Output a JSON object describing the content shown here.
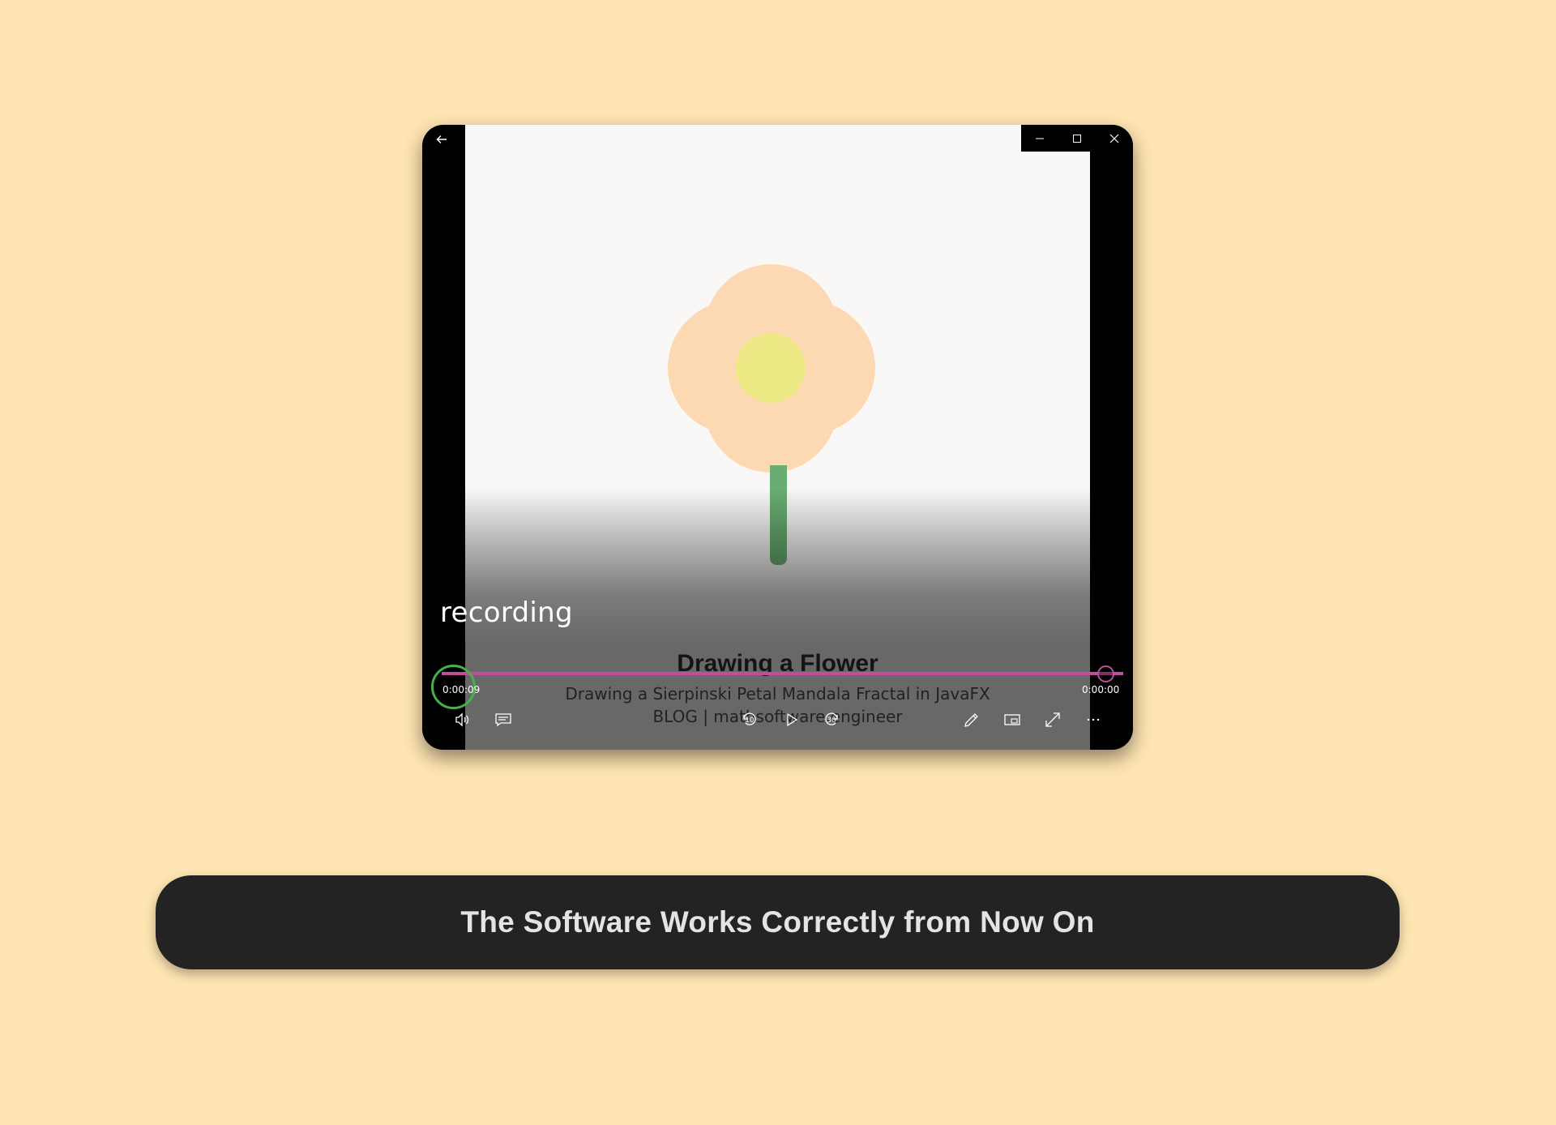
{
  "player": {
    "video_title": "Drawing a Flower",
    "video_subtitle_line1": "Drawing a Sierpinski Petal Mandala Fractal in JavaFX",
    "video_subtitle_line2": "BLOG | mathsoftware.engineer",
    "caption": "recording",
    "current_time": "0:00:09",
    "remaining_time": "0:00:00",
    "progress": 1.0,
    "skip_back_seconds": "10",
    "skip_forward_seconds": "30",
    "accent_color": "#c44c9d",
    "highlight_color": "#46b04b",
    "icons": [
      "back-arrow-icon",
      "minimize-icon",
      "maximize-icon",
      "close-icon",
      "volume-icon",
      "subtitles-icon",
      "skip-back-icon",
      "play-icon",
      "skip-forward-icon",
      "edit-pencil-icon",
      "miniplayer-icon",
      "fullscreen-icon",
      "more-icon"
    ]
  },
  "banner": {
    "text": "The Software Works Correctly from Now On"
  },
  "colors": {
    "background": "#ffe5b2",
    "petal": "#fdd9b3",
    "flower_center": "#ece984",
    "stem": "#69ad72",
    "banner_bg": "#232323"
  }
}
